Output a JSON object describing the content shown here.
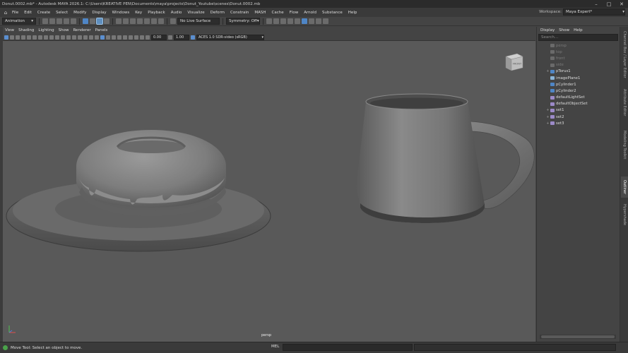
{
  "window": {
    "title": "Donut.0002.mb* - Autodesk MAYA 2026.1: C:\\Users\\KREATIVE PEN\\Documents\\maya\\projects\\Donut_Youtube\\scenes\\Donut.0002.mb",
    "minimize": "–",
    "maximize": "□",
    "close": "✕"
  },
  "menu": {
    "home_icon": "home-icon",
    "items": [
      "File",
      "Edit",
      "Create",
      "Select",
      "Modify",
      "Display",
      "Windows",
      "Key",
      "Playback",
      "Audio",
      "Visualize",
      "Deform",
      "Constrain",
      "MASH",
      "Cache",
      "Flow",
      "Arnold",
      "Substance",
      "Help"
    ],
    "workspace_label": "Workspace:",
    "workspace_value": "Maya Expert*"
  },
  "shelf": {
    "mode": "Animation",
    "live_surface": "No Live Surface",
    "symmetry": "Symmetry: Off"
  },
  "panel": {
    "menu_items": [
      "View",
      "Shading",
      "Lighting",
      "Show",
      "Renderer",
      "Panels"
    ],
    "exposure": "0.00",
    "gamma": "1.00",
    "color_space": "ACES 1.0 SDR-video (sRGB)"
  },
  "viewport": {
    "camera_label": "persp",
    "viewcube_label": "FRONT",
    "background": "#595959"
  },
  "outliner": {
    "menu_items": [
      "Display",
      "Show",
      "Help"
    ],
    "search_placeholder": "Search...",
    "items": [
      {
        "label": "persp",
        "dim": true,
        "expand": "",
        "icon": "camera-icon"
      },
      {
        "label": "top",
        "dim": true,
        "expand": "",
        "icon": "camera-icon"
      },
      {
        "label": "front",
        "dim": true,
        "expand": "",
        "icon": "camera-icon"
      },
      {
        "label": "side",
        "dim": true,
        "expand": "",
        "icon": "camera-icon"
      },
      {
        "label": "pTorus1",
        "dim": false,
        "expand": "+",
        "icon": "mesh-icon"
      },
      {
        "label": "imagePlane1",
        "dim": false,
        "expand": "",
        "icon": "image-plane-icon"
      },
      {
        "label": "pCylinder1",
        "dim": false,
        "expand": "",
        "icon": "mesh-icon"
      },
      {
        "label": "pCylinder2",
        "dim": false,
        "expand": "",
        "icon": "mesh-icon"
      },
      {
        "label": "defaultLightSet",
        "dim": false,
        "expand": "",
        "icon": "set-icon"
      },
      {
        "label": "defaultObjectSet",
        "dim": false,
        "expand": "",
        "icon": "set-icon"
      },
      {
        "label": "set1",
        "dim": false,
        "expand": "+",
        "icon": "set-icon"
      },
      {
        "label": "set2",
        "dim": false,
        "expand": "+",
        "icon": "set-icon"
      },
      {
        "label": "set3",
        "dim": false,
        "expand": "+",
        "icon": "set-icon"
      }
    ]
  },
  "side_tabs": [
    "Channel Box / Layer Editor",
    "Attribute Editor",
    "Modeling Toolkit",
    "Outliner",
    "Hypershade"
  ],
  "status": {
    "help_line": "Move Tool: Select an object to move.",
    "mel_label": "MEL"
  }
}
